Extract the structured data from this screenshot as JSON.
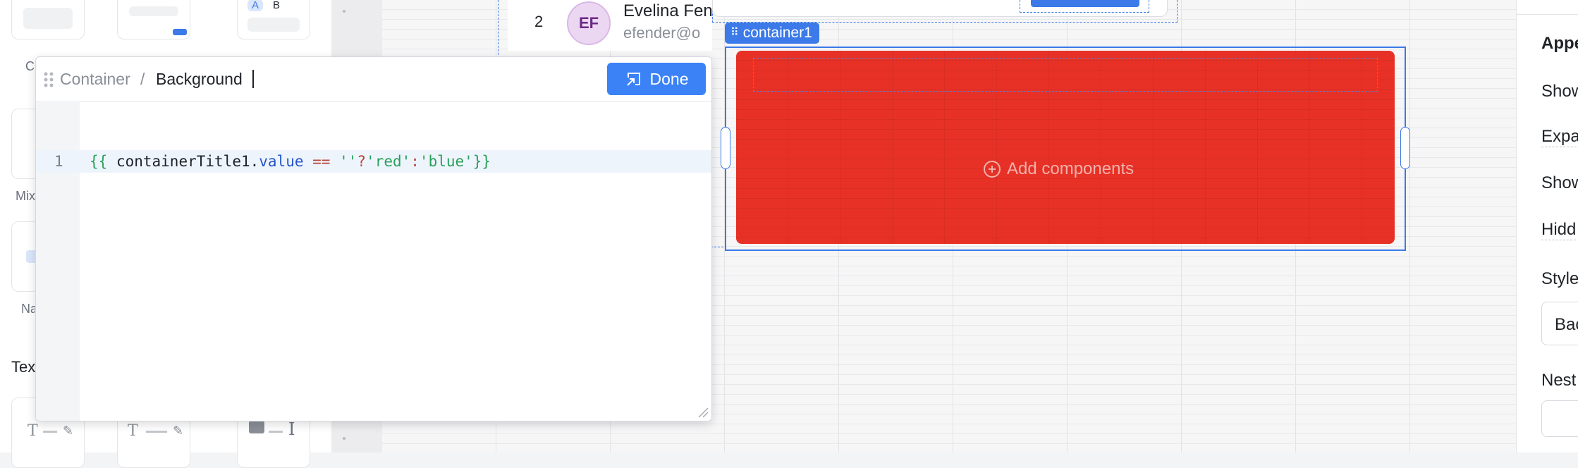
{
  "left_panel": {
    "tiles": [
      {
        "label": "C"
      },
      {
        "label": ""
      },
      {
        "label": "",
        "badge_a": "A",
        "badge_b": "B"
      },
      {
        "label": "Mix"
      },
      {
        "label": "Na"
      }
    ],
    "section_text": "Tex"
  },
  "table": {
    "row_number": "2",
    "avatar_initials": "EF",
    "person_name": "Evelina Fen",
    "person_email": "efender@o"
  },
  "canvas": {
    "container_tag": "container1",
    "add_components_label": "Add components"
  },
  "editor": {
    "breadcrumb_parent": "Container",
    "breadcrumb_separator": "/",
    "breadcrumb_current": "Background",
    "done_label": "Done",
    "line_number": "1",
    "code": {
      "open": "{{",
      "var": "containerTitle1",
      "dot": ".",
      "prop": "value",
      "op": "==",
      "empty_str": "''",
      "q": "?",
      "str_red": "'red'",
      "colon": ":",
      "str_blue": "'blue'",
      "close": "}}"
    }
  },
  "inspector": {
    "labels": [
      "Appe",
      "Show",
      "Expa",
      "Show",
      "Hidd",
      "Style",
      "Bac",
      "Nest"
    ]
  },
  "colors": {
    "accent": "#3b82f6",
    "container_bg": "#e83126",
    "avatar_bg": "#ecd7f3"
  }
}
